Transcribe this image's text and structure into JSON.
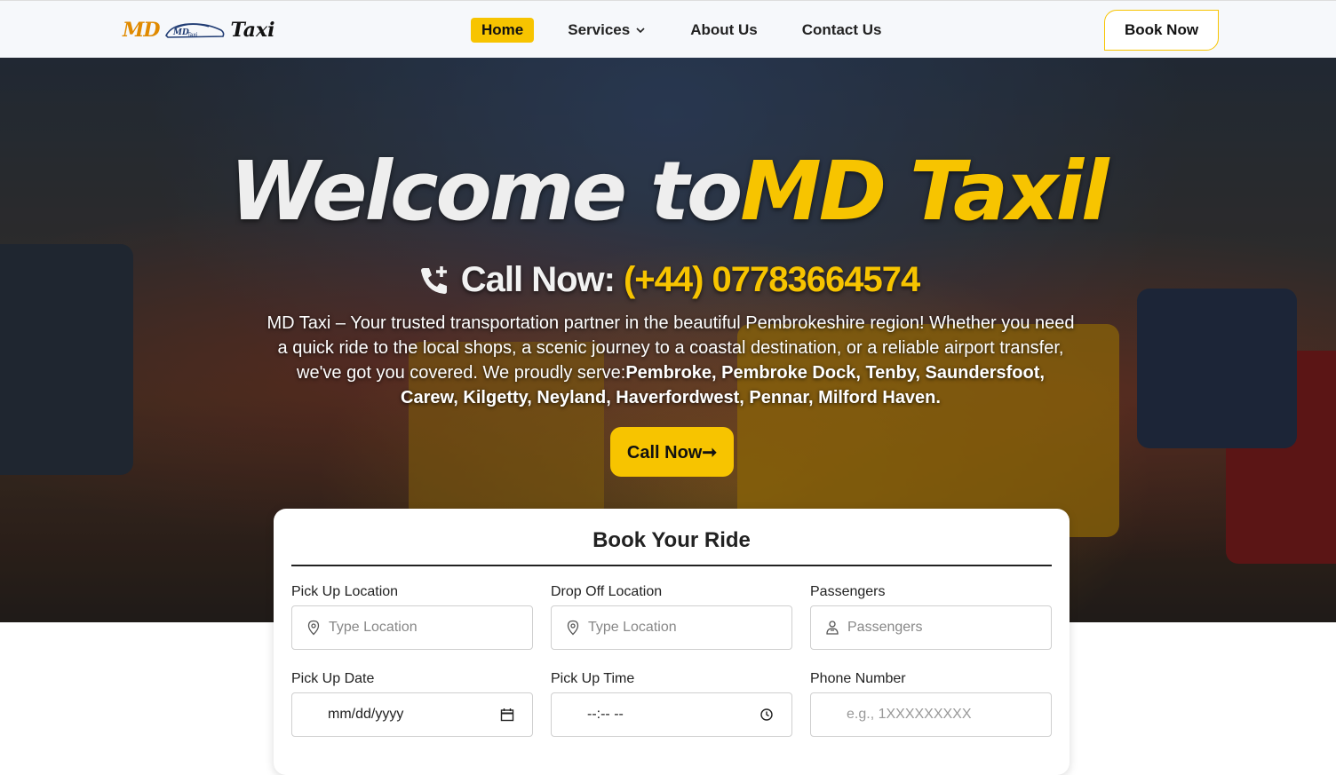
{
  "header": {
    "logo": {
      "md": "MD",
      "taxi": "Taxi",
      "car_text": "MD Taxi"
    },
    "nav": [
      {
        "label": "Home",
        "active": true
      },
      {
        "label": "Services",
        "has_dropdown": true
      },
      {
        "label": "About Us"
      },
      {
        "label": "Contact Us"
      }
    ],
    "book_now_label": "Book Now"
  },
  "hero": {
    "welcome_white": "Welcome to",
    "welcome_yellow": "MD Taxil",
    "call_label": "Call Now:",
    "call_number": "(+44) 07783664574",
    "description_plain": "MD Taxi – Your trusted transportation partner in the beautiful Pembrokeshire region! Whether you need a quick ride to the local shops, a scenic journey to a coastal destination, or a reliable airport transfer, we've got you covered. We proudly serve:",
    "description_bold": "Pembroke, Pembroke Dock, Tenby, Saundersfoot, Carew, Kilgetty, Neyland, Haverfordwest, Pennar, Milford Haven.",
    "call_button_label": "Call Now➞"
  },
  "booking": {
    "title": "Book Your Ride",
    "fields": {
      "pickup": {
        "label": "Pick Up Location",
        "placeholder": "Type Location"
      },
      "dropoff": {
        "label": "Drop Off Location",
        "placeholder": "Type Location"
      },
      "passengers": {
        "label": "Passengers",
        "placeholder": "Passengers"
      },
      "date": {
        "label": "Pick Up Date",
        "placeholder": "mm/dd/yyyy"
      },
      "time": {
        "label": "Pick Up Time",
        "placeholder": "--:-- --"
      },
      "phone": {
        "label": "Phone Number",
        "placeholder": "e.g., 1XXXXXXXXX"
      }
    }
  },
  "colors": {
    "accent": "#f7c400",
    "logo_orange": "#e08a00",
    "text_dark": "#222222"
  },
  "icons": [
    "chevron-down-icon",
    "phone-plus-icon",
    "location-pin-icon",
    "passenger-icon",
    "calendar-icon",
    "clock-icon"
  ]
}
